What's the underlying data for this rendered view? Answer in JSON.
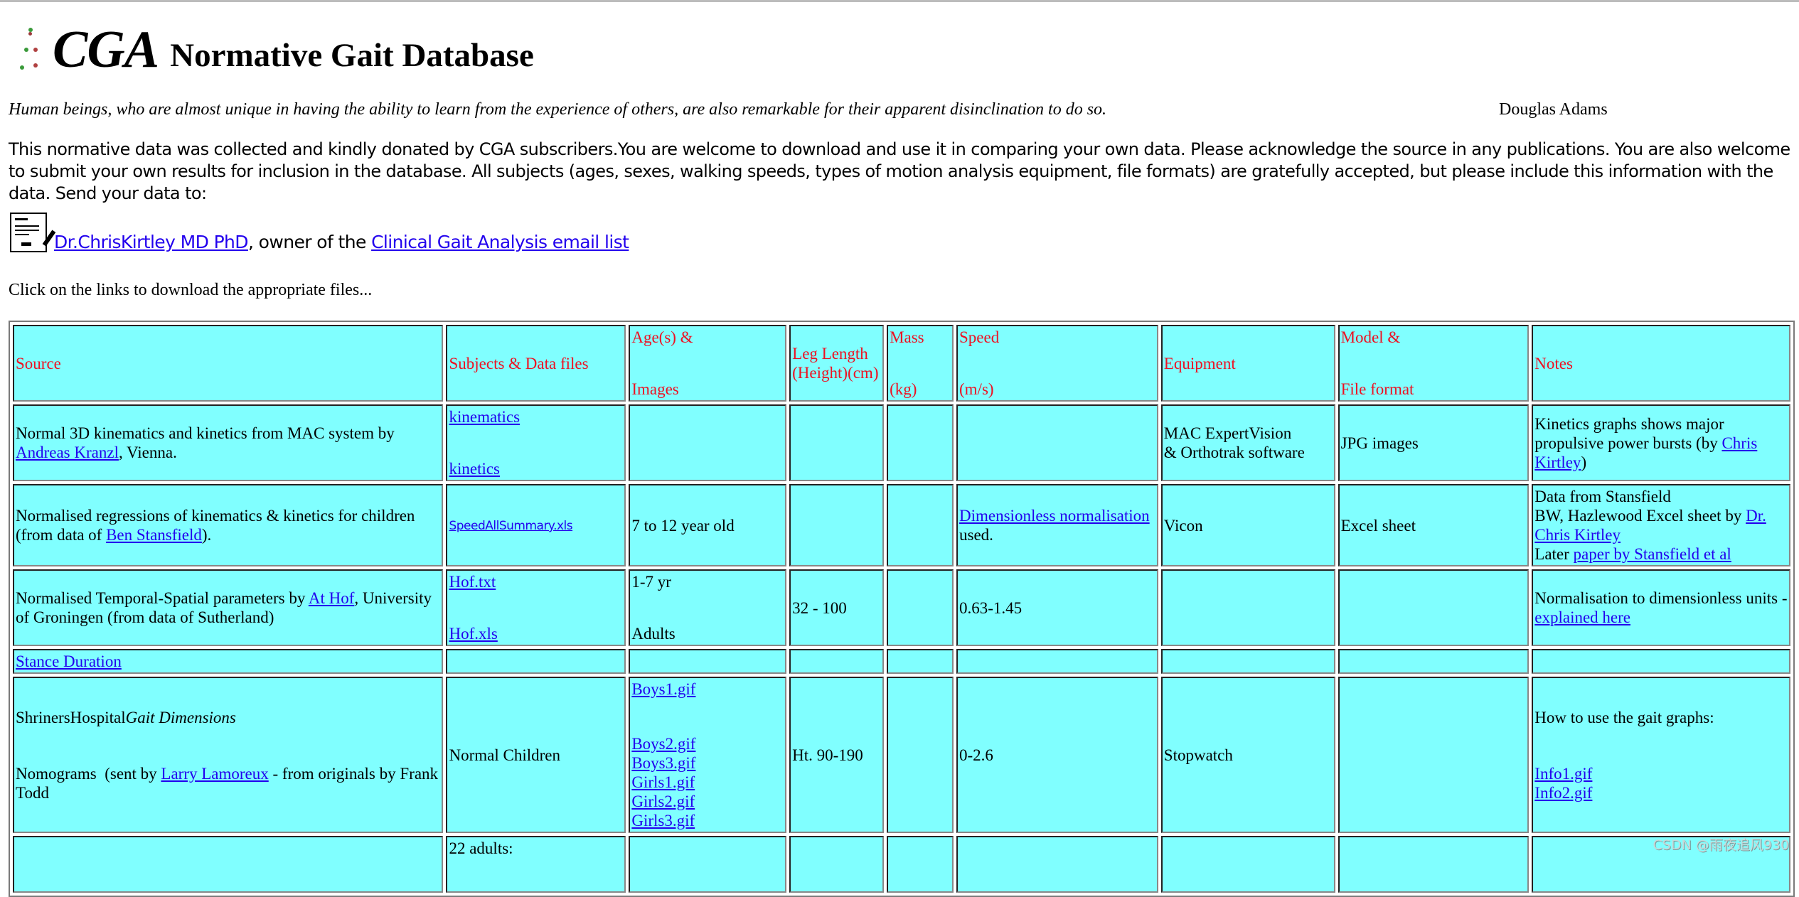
{
  "header": {
    "logo_text": "CGA",
    "title": "Normative Gait Database"
  },
  "quote": {
    "text": "Human beings, who are almost unique in having the ability to learn from the experience of others, are also remarkable for their apparent disinclination to do so.",
    "author": "Douglas Adams"
  },
  "intro": "This normative data was collected and kindly donated by CGA subscribers.You are welcome to download and use it in comparing your own data. Please acknowledge the source in any publications. You are also welcome to submit your own results for inclusion in the database. All subjects (ages, sexes, walking speeds, types of motion analysis equipment, file formats) are gratefully accepted, but please include this information with the data. Send your data to:",
  "contact": {
    "icon": "mail-letter-icon",
    "name_link": "Dr.ChrisKirtley MD PhD",
    "middle": ", owner of the ",
    "list_link": "Clinical Gait Analysis email list"
  },
  "instruction": "Click on the links to download the appropriate files...",
  "table": {
    "headers": {
      "source": "Source",
      "subjects": "Subjects & Data files",
      "age_top": "Age(s) &",
      "age_bottom": "Images",
      "leg_length": "Leg Length (Height)(cm)",
      "mass_top": "Mass",
      "mass_bottom": "(kg)",
      "speed_top": "Speed",
      "speed_bottom": "(m/s)",
      "equipment": "Equipment",
      "model_top": "Model &",
      "model_bottom": "File format",
      "notes": "Notes"
    },
    "rows": [
      {
        "source_text": "Normal 3D kinematics and kinetics from MAC system by ",
        "source_link": "Andreas Kranzl",
        "source_suffix": ", Vienna.",
        "files": [
          "kinematics",
          "kinetics"
        ],
        "equipment": "MAC ExpertVision & Orthotrak software",
        "equipment_line1": "MAC ExpertVision",
        "equipment_line2": "& Orthotrak software",
        "model": "JPG images",
        "notes_text": "Kinetics graphs shows major propulsive power bursts (by ",
        "notes_link": "Chris Kirtley",
        "notes_suffix": ")"
      },
      {
        "source_text": "Normalised regressions of kinematics & kinetics for children (from data of ",
        "source_link": "Ben Stansfield",
        "source_suffix": ").",
        "files": [
          "SpeedAllSummary.xls"
        ],
        "age": "7 to 12 year old",
        "speed_link": "Dimensionless normalisation",
        "speed_suffix": " used.",
        "equipment": "Vicon",
        "model": "Excel sheet",
        "notes_line1": "Data from Stansfield",
        "notes_line2": "BW, Hazlewood Excel sheet by ",
        "notes_link": "Dr. Chris Kirtley",
        "notes_later": "Later ",
        "notes_link2": "paper by Stansfield et al"
      },
      {
        "source_text": "Normalised Temporal-Spatial parameters by ",
        "source_link": "At Hof",
        "source_suffix": ", University of Groningen (from data of Sutherland)",
        "files": [
          "Hof.txt",
          "Hof.xls"
        ],
        "ages": [
          "1-7 yr",
          "Adults"
        ],
        "leg_length": "32 - 100",
        "speed": "0.63-1.45",
        "notes_text": "Normalisation to dimensionless units - ",
        "notes_link": "explained here"
      },
      {
        "source_link": "Stance Duration"
      },
      {
        "source_prefix": "ShrinersHospital",
        "source_italic": "Gait Dimensions",
        "source_text2": "Nomograms  (sent by ",
        "source_link": "Larry Lamoreux",
        "source_suffix": " - from originals by Frank Todd",
        "subjects": "Normal Children",
        "images": [
          "Boys1.gif",
          "Boys2.gif",
          "Boys3.gif",
          "Girls1.gif",
          "Girls2.gif",
          "Girls3.gif"
        ],
        "leg_length": "Ht. 90-190",
        "speed": "0-2.6",
        "equipment": "Stopwatch",
        "notes_text": "How to use the gait graphs:",
        "notes_links": [
          "Info1.gif",
          "Info2.gif"
        ]
      },
      {
        "subjects": "22 adults:"
      }
    ]
  },
  "watermark": "CSDN @雨夜追风930",
  "colors": {
    "cell_bg": "#80ffff",
    "header_text": "#ee1122",
    "link": "#2200ee"
  }
}
